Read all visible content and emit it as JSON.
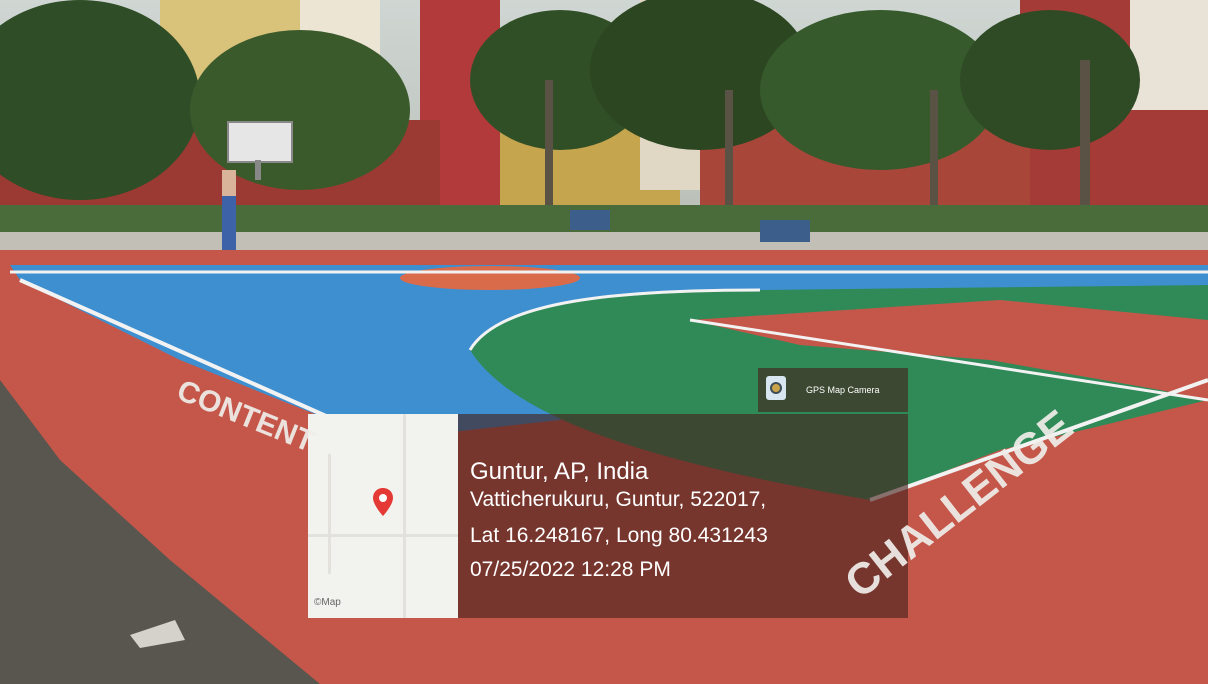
{
  "scene": {
    "description_icon": "basketball-court-photo"
  },
  "badge": {
    "label": "GPS Map Camera",
    "icon": "camera-icon"
  },
  "map": {
    "watermark": "©Map",
    "pin_icon": "location-pin-icon",
    "pin_color": "#e53935"
  },
  "location": {
    "city": "Guntur, AP, India",
    "address": "Vatticherukuru, Guntur, 522017,",
    "lat_long": "Lat 16.248167, Long 80.431243",
    "datetime": "07/25/2022 12:28 PM"
  },
  "court_text": {
    "left": "CONTENT",
    "right": "CHALLENGE"
  }
}
